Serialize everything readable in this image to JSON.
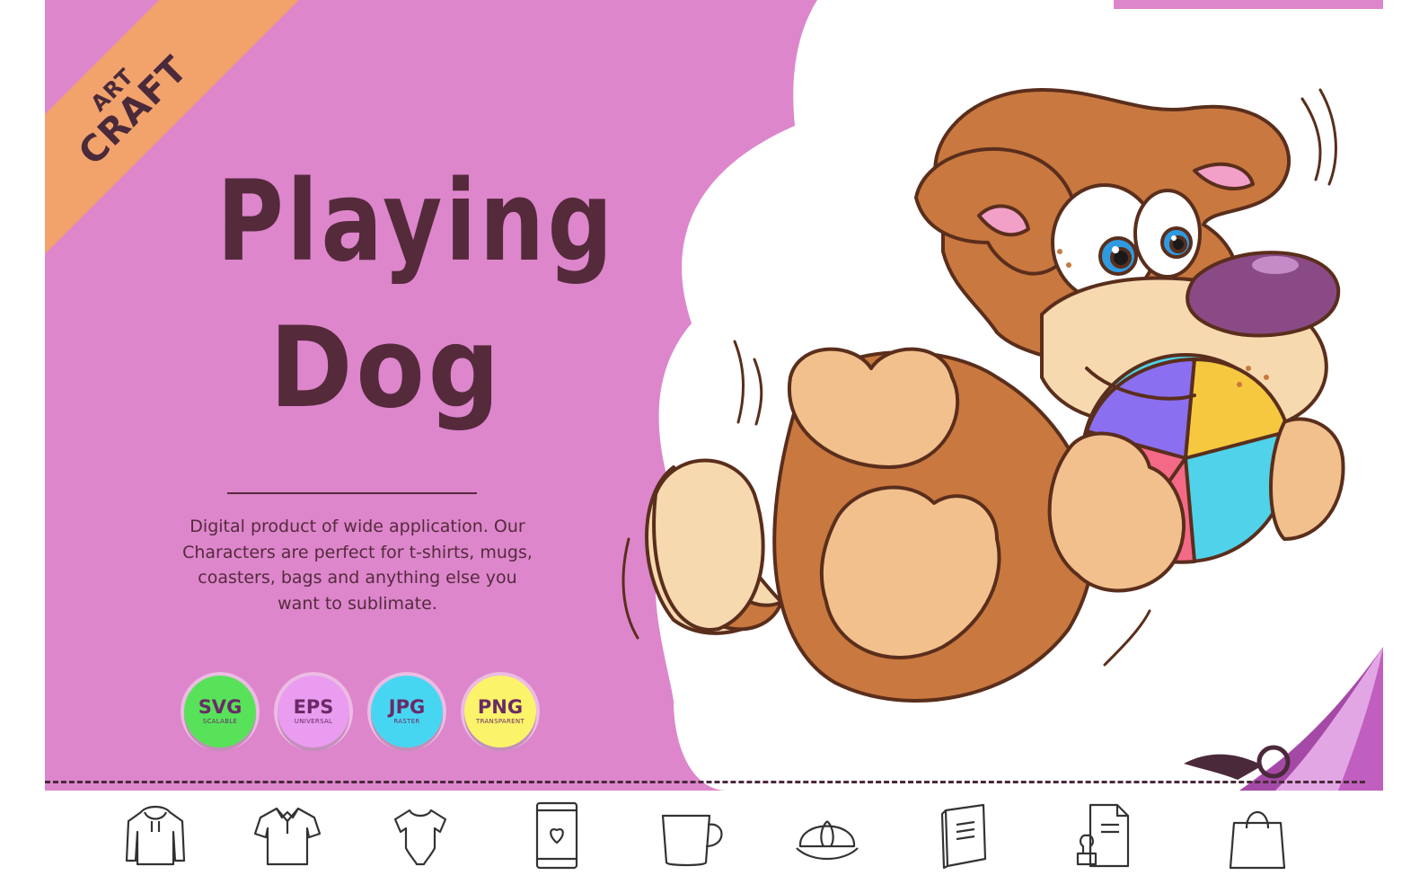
{
  "ribbon": {
    "line1": "ART",
    "line2": "CRAFT"
  },
  "title": {
    "line1": "Playing",
    "line2": "Dog"
  },
  "description": "Digital product of wide application. Our Characters are perfect for t-shirts, mugs, coasters, bags and anything else you want to sublimate.",
  "formats": [
    {
      "label": "SVG",
      "sub": "SCALABLE",
      "color": "#58e25a"
    },
    {
      "label": "EPS",
      "sub": "UNIVERSAL",
      "color": "#ea9cf0"
    },
    {
      "label": "JPG",
      "sub": "RASTER",
      "color": "#47d6f2"
    },
    {
      "label": "PNG",
      "sub": "TRANSPARENT",
      "color": "#fbf36a"
    }
  ],
  "colors": {
    "panel": "#dd86cc",
    "ribbon": "#f2a26b",
    "title_text": "#552a3b",
    "dog_fur": "#c9783f",
    "dog_muzzle": "#f7d9b0",
    "dog_nose": "#8a4a86"
  },
  "product_icons": [
    "hoodie-icon",
    "polo-shirt-icon",
    "baby-bodysuit-icon",
    "phone-case-icon",
    "mug-icon",
    "cap-icon",
    "notebook-icon",
    "stamp-document-icon",
    "shopping-bag-icon"
  ]
}
